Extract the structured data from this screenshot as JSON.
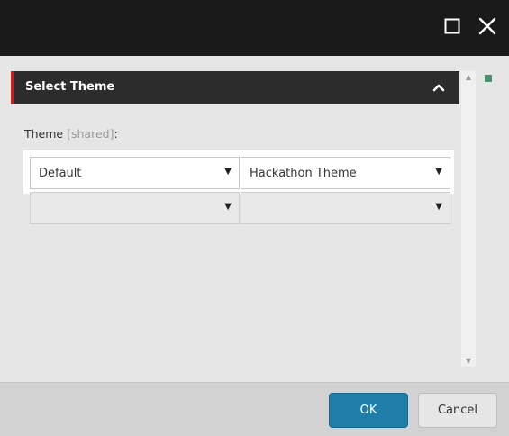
{
  "window": {
    "maximize_icon": "maximize-icon",
    "close_icon": "close-icon"
  },
  "panel": {
    "title": "Select Theme",
    "collapse_icon": "chevron-up-icon"
  },
  "field": {
    "label": "Theme",
    "shared": "[shared]",
    "colon": ":"
  },
  "selects": {
    "row1": {
      "left": "Default",
      "right": "Hackathon Theme"
    },
    "row2": {
      "left": "",
      "right": ""
    },
    "arrow_icon": "dropdown-arrow-icon"
  },
  "footer": {
    "ok_label": "OK",
    "cancel_label": "Cancel"
  },
  "colors": {
    "accent": "#1f7ea8",
    "header_accent": "#c0201f",
    "header_bg": "#2c2c2c",
    "indicator": "#4a8f6e"
  }
}
